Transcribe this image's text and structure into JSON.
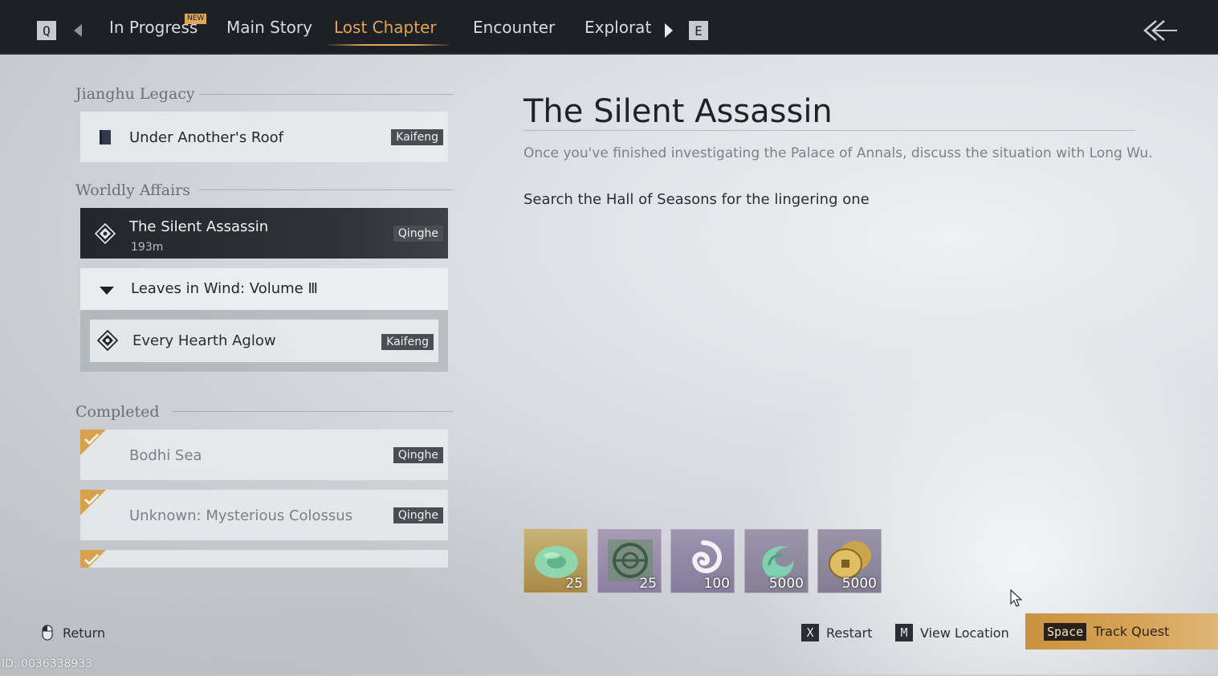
{
  "topbar": {
    "key_left": "Q",
    "key_right": "E",
    "tabs": [
      {
        "label": "In Progress",
        "badge": "NEW"
      },
      {
        "label": "Main Story"
      },
      {
        "label": "Lost Chapter",
        "active": true
      },
      {
        "label": "Encounter"
      },
      {
        "label": "Explorati"
      }
    ],
    "accent_color": "#e2a455"
  },
  "sections": {
    "legacy": "Jianghu Legacy",
    "affairs": "Worldly Affairs",
    "completed": "Completed"
  },
  "quests": {
    "legacy_items": [
      {
        "title": "Under Another's Roof",
        "location": "Kaifeng",
        "icon": "book-icon"
      }
    ],
    "affairs_active": {
      "title": "The Silent Assassin",
      "distance": "193m",
      "location": "Qinghe",
      "icon": "diamond-quest-icon"
    },
    "group": {
      "title": "Leaves in Wind: Volume Ⅲ"
    },
    "group_items": [
      {
        "title": "Every Hearth Aglow",
        "location": "Kaifeng",
        "icon": "diamond-quest-icon"
      }
    ],
    "completed_items": [
      {
        "title": "Bodhi Sea",
        "location": "Qinghe"
      },
      {
        "title": "Unknown: Mysterious Colossus",
        "location": "Qinghe"
      }
    ]
  },
  "detail": {
    "title": "The Silent Assassin",
    "description": "Once you've finished investigating the Palace of Annals, discuss the situation with Long Wu.",
    "objective": "Search the Hall of Seasons for the lingering one",
    "rewards": [
      {
        "icon": "jade-ring-icon",
        "count": "25"
      },
      {
        "icon": "jade-disc-icon",
        "count": "25"
      },
      {
        "icon": "swirl-icon",
        "count": "100"
      },
      {
        "icon": "wind-emblem-icon",
        "count": "5000"
      },
      {
        "icon": "coins-icon",
        "count": "5000"
      }
    ]
  },
  "bottom": {
    "return_label": "Return",
    "restart_key": "X",
    "restart_label": "Restart",
    "location_key": "M",
    "location_label": "View Location",
    "track_key": "Space",
    "track_label": "Track Quest"
  },
  "uid": "ID: 0036338933"
}
